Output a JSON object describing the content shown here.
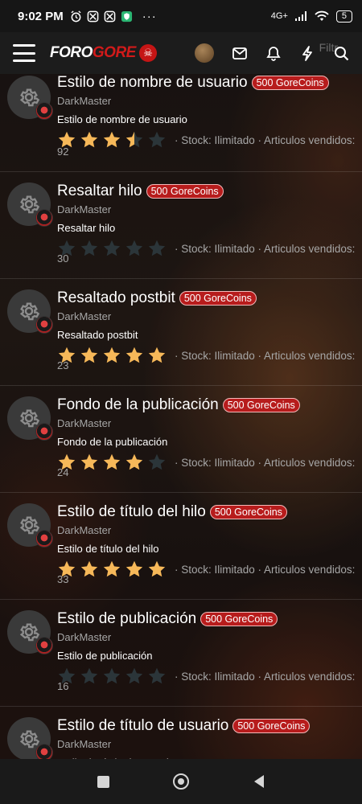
{
  "status_bar": {
    "time": "9:02 PM",
    "network": "4G+",
    "battery": "5"
  },
  "header": {
    "logo_part1": "FORO",
    "logo_part2": "GORE",
    "filter_ghost": "Filtr"
  },
  "items": [
    {
      "title": "Estilo de nombre de usuario",
      "price": "500 GoreCoins",
      "author": "DarkMaster",
      "description": "Estilo de nombre de usuario",
      "rating": 3.5,
      "stock": "· Stock: Ilimitado · Articulos vendidos:",
      "sold": "92"
    },
    {
      "title": "Resaltar hilo",
      "price": "500 GoreCoins",
      "author": "DarkMaster",
      "description": "Resaltar hilo",
      "rating": 0,
      "stock": "· Stock: Ilimitado · Articulos vendidos:",
      "sold": "30"
    },
    {
      "title": "Resaltado postbit",
      "price": "500 GoreCoins",
      "author": "DarkMaster",
      "description": "Resaltado postbit",
      "rating": 5,
      "stock": "· Stock: Ilimitado · Articulos vendidos:",
      "sold": "23"
    },
    {
      "title": "Fondo de la publicación",
      "price": "500 GoreCoins",
      "author": "DarkMaster",
      "description": "Fondo de la publicación",
      "rating": 4,
      "stock": "· Stock: Ilimitado · Articulos vendidos:",
      "sold": "24"
    },
    {
      "title": "Estilo de título del hilo",
      "price": "500 GoreCoins",
      "author": "DarkMaster",
      "description": "Estilo de título del hilo",
      "rating": 5,
      "stock": "· Stock: Ilimitado · Articulos vendidos:",
      "sold": "33"
    },
    {
      "title": "Estilo de publicación",
      "price": "500 GoreCoins",
      "author": "DarkMaster",
      "description": "Estilo de publicación",
      "rating": 0,
      "stock": "· Stock: Ilimitado · Articulos vendidos:",
      "sold": "16"
    },
    {
      "title": "Estilo de título de usuario",
      "price": "500 GoreCoins",
      "author": "DarkMaster",
      "description": "Estilo de título de usuario",
      "rating": 0,
      "stock": "",
      "sold": ""
    }
  ],
  "icons": {
    "item_icon": "gear-icon",
    "star": "star-icon",
    "menu": "hamburger-menu-icon",
    "inbox": "mail-icon",
    "alerts": "bell-icon",
    "whats_new": "lightning-icon",
    "search": "search-icon"
  },
  "colors": {
    "badge_bg": "#b71c1c",
    "star_filled": "#f6b859",
    "star_empty": "#2b3539",
    "brand_red": "#d11a1a"
  }
}
